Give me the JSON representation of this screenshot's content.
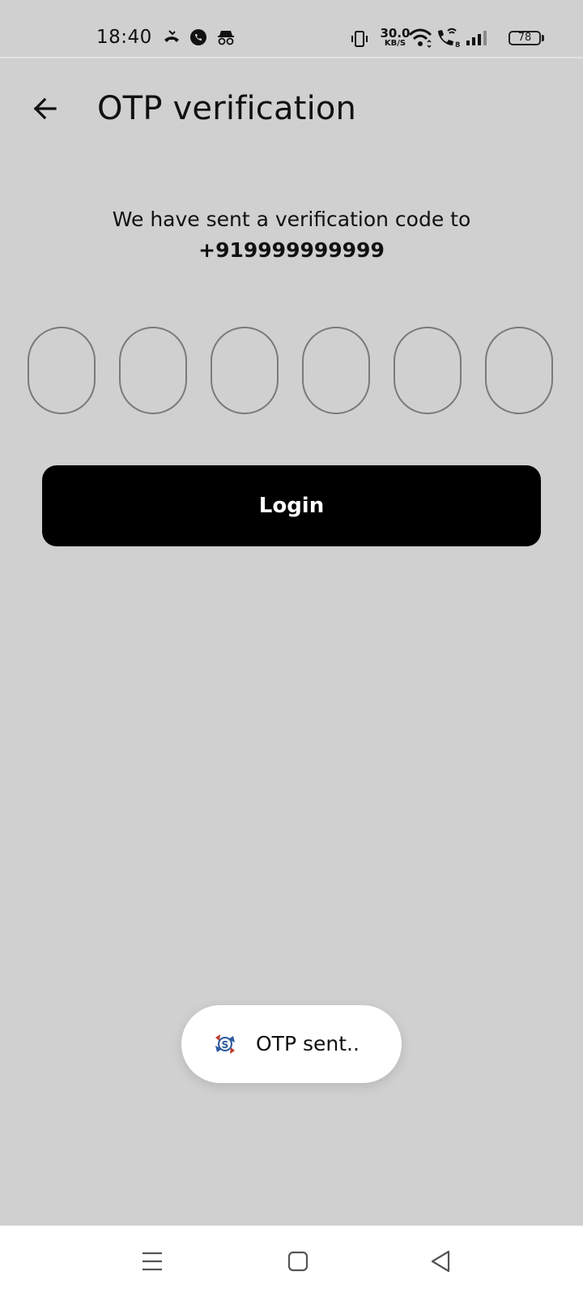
{
  "status_bar": {
    "time": "18:40",
    "left_icons": [
      "missed-call-icon",
      "whatsapp-icon",
      "incognito-icon"
    ],
    "network_speed_value": "30.0",
    "network_speed_unit": "KB/S",
    "right_icons": [
      "vibrate-icon",
      "wifi-icon",
      "wifi-calling-icon",
      "signal-icon"
    ],
    "battery": "78"
  },
  "header": {
    "back_icon": "arrow-left-icon",
    "title": "OTP verification"
  },
  "content": {
    "message": "We have sent a verification code to",
    "phone_number": "+919999999999",
    "otp_digits": [
      "",
      "",
      "",
      "",
      "",
      ""
    ]
  },
  "actions": {
    "login_label": "Login"
  },
  "toast": {
    "icon": "app-logo-icon",
    "text": "OTP sent.."
  },
  "nav_bar": {
    "buttons": [
      "recent-apps-icon",
      "home-icon",
      "back-triangle-icon"
    ]
  },
  "colors": {
    "background": "#d0d0d0",
    "button": "#000000",
    "button_text": "#ffffff",
    "otp_border": "#7a7a7a"
  }
}
